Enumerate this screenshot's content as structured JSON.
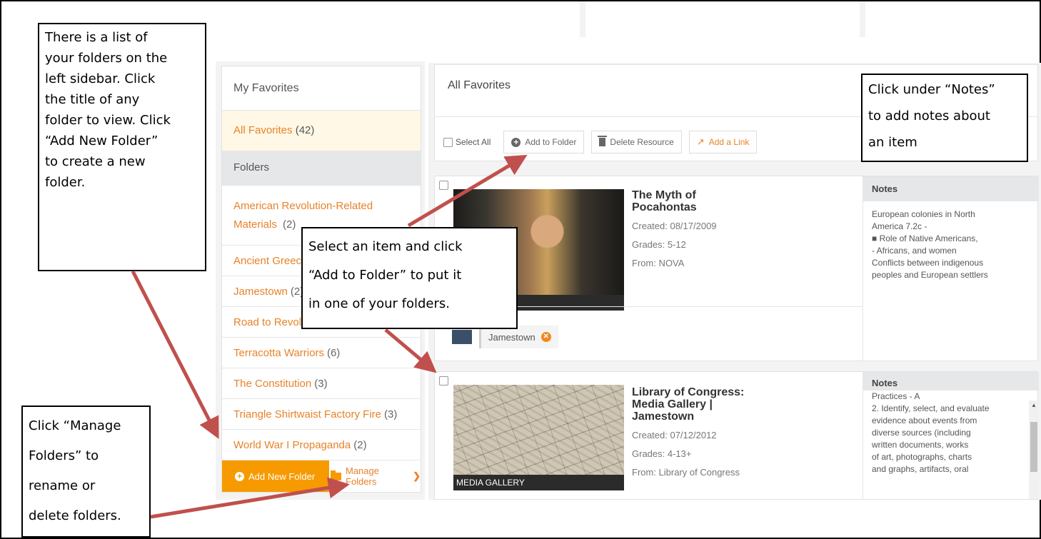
{
  "sidebar": {
    "title": "My Favorites",
    "all_label": "All Favorites",
    "all_count": "(42)",
    "folders_header": "Folders",
    "folders": [
      {
        "label": "American Revolution-Related Materials",
        "count": "(2)"
      },
      {
        "label": "Ancient Greece",
        "count": ""
      },
      {
        "label": "Jamestown",
        "count": "(2)"
      },
      {
        "label": "Road to Revolution",
        "count": ""
      },
      {
        "label": "Terracotta Warriors",
        "count": "(6)"
      },
      {
        "label": "The Constitution",
        "count": "(3)"
      },
      {
        "label": "Triangle Shirtwaist Factory Fire",
        "count": "(3)"
      },
      {
        "label": "World War I Propaganda",
        "count": "(2)"
      }
    ],
    "add_folder": "Add New Folder",
    "manage_folders": "Manage Folders",
    "chevron": "❯"
  },
  "main": {
    "title": "All Favorites",
    "toolbar": {
      "select_all": "Select All",
      "add_to_folder": "Add to Folder",
      "delete_resource": "Delete Resource",
      "add_link": "Add a Link"
    }
  },
  "items": [
    {
      "title": "The Myth of Pocahontas",
      "created": "Created: 08/17/2009",
      "grades": "Grades: 5-12",
      "from": "From: NOVA",
      "notes_label": "Notes",
      "notes": [
        "European colonies in North",
        "America 7.2c -",
        "■ Role of Native Americans,",
        "- Africans, and women",
        "Conflicts between indigenous",
        "peoples and European settlers"
      ],
      "folder_tag": "Jamestown"
    },
    {
      "title_lines": [
        "Library of Congress:",
        "Media Gallery |",
        "Jamestown"
      ],
      "created": "Created: 07/12/2012",
      "grades": "Grades: 4-13+",
      "from": "From: Library of Congress",
      "badge": "MEDIA GALLERY",
      "notes_label": "Notes",
      "notes": [
        "Practices - A",
        "2. Identify, select, and evaluate",
        "evidence about events from",
        "diverse sources (including",
        "written documents, works",
        "of art, photographs, charts",
        "and graphs, artifacts, oral"
      ]
    }
  ],
  "callouts": {
    "sidebar_help": [
      "There is a list of",
      "your folders on the",
      "left sidebar. Click",
      "the title of any",
      "folder to view. Click",
      "“Add New Folder”",
      "to create a new",
      "folder."
    ],
    "notes_help": [
      "Click under “Notes”",
      "to add notes about",
      "an item"
    ],
    "add_folder_help": [
      "Select an item and click",
      "“Add to Folder” to put it",
      "in one of your folders."
    ],
    "manage_help": [
      "Click “Manage",
      "Folders” to",
      "rename or",
      "delete folders."
    ]
  },
  "colors": {
    "accent": "#f79a00",
    "link": "#e8822a",
    "arrow": "#c0504d"
  }
}
